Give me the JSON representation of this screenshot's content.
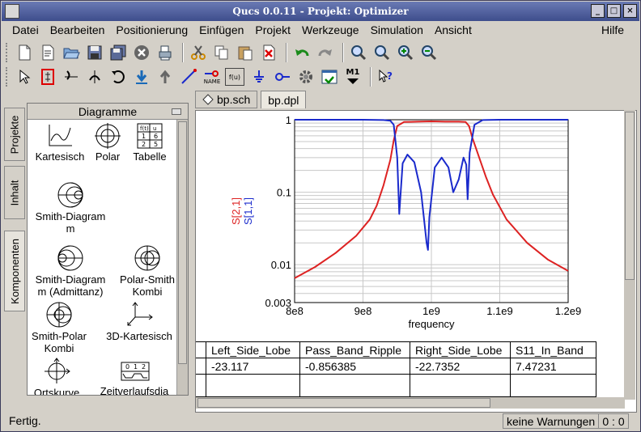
{
  "window": {
    "title": "Qucs 0.0.11 - Projekt: Optimizer"
  },
  "menu": [
    "Datei",
    "Bearbeiten",
    "Positionierung",
    "Einfügen",
    "Projekt",
    "Werkzeuge",
    "Simulation",
    "Ansicht"
  ],
  "menu_help": "Hilfe",
  "toolbar": {
    "row1": [
      "new-file-icon",
      "new-text-icon",
      "open-folder-icon",
      "save-icon",
      "save-all-icon",
      "close-icon",
      "print-icon",
      "cut-icon",
      "copy-icon",
      "paste-icon",
      "delete-icon",
      "undo-icon",
      "redo-icon",
      "zoom-fit-icon",
      "zoom-1to1-icon",
      "zoom-in-icon",
      "zoom-out-icon"
    ],
    "row2": [
      "select-icon",
      "deactivate-icon",
      "mirror-x-icon",
      "mirror-y-icon",
      "rotate-icon",
      "enter-subcircuit-icon",
      "leave-subcircuit-icon",
      "wire-icon",
      "wire-label-icon",
      "equation-icon",
      "ground-icon",
      "port-icon",
      "simulate-icon",
      "view-data-icon",
      "marker-icon",
      "whats-this-icon"
    ],
    "wire_label_text": "NAME",
    "equation_text": "f(u)",
    "marker_text": "M1"
  },
  "side_tabs": [
    "Projekte",
    "Inhalt",
    "Komponenten"
  ],
  "components_panel": {
    "title": "Diagramme",
    "items": [
      "Kartesisch",
      "Polar",
      "Tabelle",
      "Smith-Diagram m",
      "Smith-Diagram m (Admittanz)",
      "Polar-Smith Kombi",
      "Smith-Polar Kombi",
      "3D-Kartesisch",
      "Ortskurve",
      "Zeitverlaufsdia gramm"
    ],
    "table_icon_text": [
      "f(t)",
      "u",
      "1",
      "6",
      "2",
      "5",
      "3",
      "0"
    ],
    "timing_icon_text": [
      "0",
      "1",
      "2"
    ]
  },
  "doc_tabs": [
    {
      "label": "bp.sch",
      "icon": "schematic-icon"
    },
    {
      "label": "bp.dpl",
      "icon": ""
    }
  ],
  "chart_data": {
    "type": "line",
    "xlabel": "frequency",
    "ylabel_series": [
      "S[2,1]",
      "S[1,1]"
    ],
    "xlim": [
      800000000,
      1200000000
    ],
    "ylim": [
      0.003,
      1
    ],
    "yscale": "log",
    "grid": true,
    "x_tick_labels": [
      "8e8",
      "9e8",
      "1e9",
      "1.1e9",
      "1.2e9"
    ],
    "y_tick_labels": [
      "0.003",
      "0.01",
      "0.1",
      "1"
    ],
    "colors": {
      "S[2,1]": "#dd2222",
      "S[1,1]": "#1a2acc"
    },
    "series": [
      {
        "name": "S[2,1]",
        "x": [
          800000000,
          830000000,
          860000000,
          890000000,
          910000000,
          920000000,
          930000000,
          940000000,
          945000000,
          950000000,
          960000000,
          980000000,
          1000000000,
          1020000000,
          1040000000,
          1050000000,
          1055000000,
          1060000000,
          1070000000,
          1080000000,
          1090000000,
          1110000000,
          1140000000,
          1170000000,
          1200000000
        ],
        "y": [
          0.0065,
          0.0093,
          0.0145,
          0.025,
          0.042,
          0.065,
          0.125,
          0.28,
          0.52,
          0.82,
          0.93,
          0.94,
          0.95,
          0.94,
          0.94,
          0.93,
          0.82,
          0.56,
          0.3,
          0.16,
          0.093,
          0.042,
          0.02,
          0.0118,
          0.0082
        ]
      },
      {
        "name": "S[1,1]",
        "x": [
          800000000,
          900000000,
          930000000,
          940000000,
          945000000,
          950000000,
          953000000,
          958000000,
          965000000,
          975000000,
          985000000,
          993000000,
          995000000,
          997000000,
          1005000000,
          1015000000,
          1025000000,
          1032000000,
          1040000000,
          1047000000,
          1051000000,
          1053000000,
          1056000000,
          1063000000,
          1075000000,
          1100000000,
          1200000000
        ],
        "y": [
          1,
          1,
          0.99,
          0.97,
          0.85,
          0.3,
          0.05,
          0.25,
          0.33,
          0.26,
          0.1,
          0.02,
          0.016,
          0.045,
          0.22,
          0.3,
          0.22,
          0.1,
          0.15,
          0.3,
          0.24,
          0.08,
          0.35,
          0.85,
          0.99,
          1,
          1
        ]
      }
    ]
  },
  "results_table": {
    "headers": [
      "r",
      "Left_Side_Lobe",
      "Pass_Band_Ripple",
      "Right_Side_Lobe",
      "S11_In_Band"
    ],
    "values": [
      "",
      "-23.117",
      "-0.856385",
      "-22.7352",
      "7.47231"
    ]
  },
  "status": {
    "message": "Fertig.",
    "warnings": "keine Warnungen",
    "position": "0 : 0"
  }
}
